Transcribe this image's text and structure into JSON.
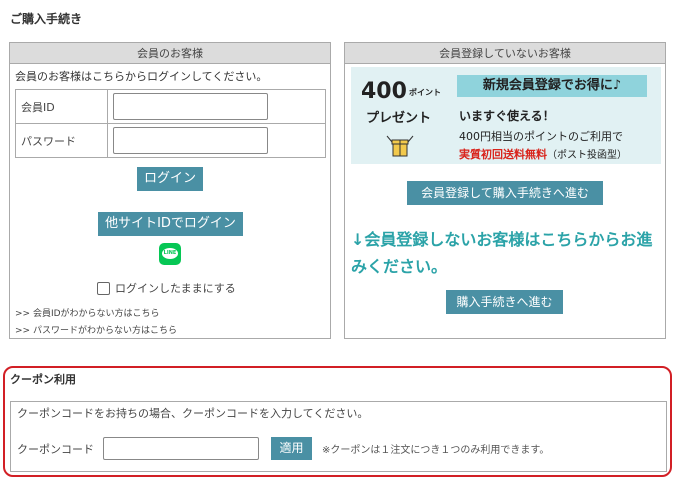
{
  "page": {
    "title": "ご購入手続き"
  },
  "member": {
    "header": "会員のお客様",
    "intro": "会員のお客様はこちらからログインしてください。",
    "id_label": "会員ID",
    "password_label": "パスワード",
    "id_value": "",
    "password_value": "",
    "login_button": "ログイン",
    "other_login_button": "他サイトIDでログイン",
    "line_icon_text": "LINE",
    "keep_logged_in": "ログインしたままにする",
    "forgot_id": ">> 会員IDがわからない方はこちら",
    "forgot_password": ">> パスワードがわからない方はこちら"
  },
  "guest": {
    "header": "会員登録していないお客様",
    "banner": {
      "points": "400",
      "points_unit": "ポイント",
      "present": "プレゼント",
      "tag": "新規会員登録でお得に♪",
      "line1": "いますぐ使える！",
      "line2": "400円相当のポイントのご利用で",
      "line3": "実質初回送料無料",
      "line3_sub": "（ポスト投函型）"
    },
    "register_button": "会員登録して購入手続きへ進む",
    "message": "↓会員登録しないお客様はこちらからお進みください。",
    "proceed_button": "購入手続きへ進む"
  },
  "coupon": {
    "title": "クーポン利用",
    "note": "クーポンコードをお持ちの場合、クーポンコードを入力してください。",
    "label": "クーポンコード",
    "value": "",
    "apply_button": "適用",
    "limit_note": "※クーポンは１注文につき１つのみ利用できます。"
  },
  "colors": {
    "accent": "#4a90a4",
    "highlight_text": "#2ba3a8",
    "coupon_border": "#d21f25",
    "banner_bg": "#e1f1f3",
    "line_green": "#06c755"
  }
}
